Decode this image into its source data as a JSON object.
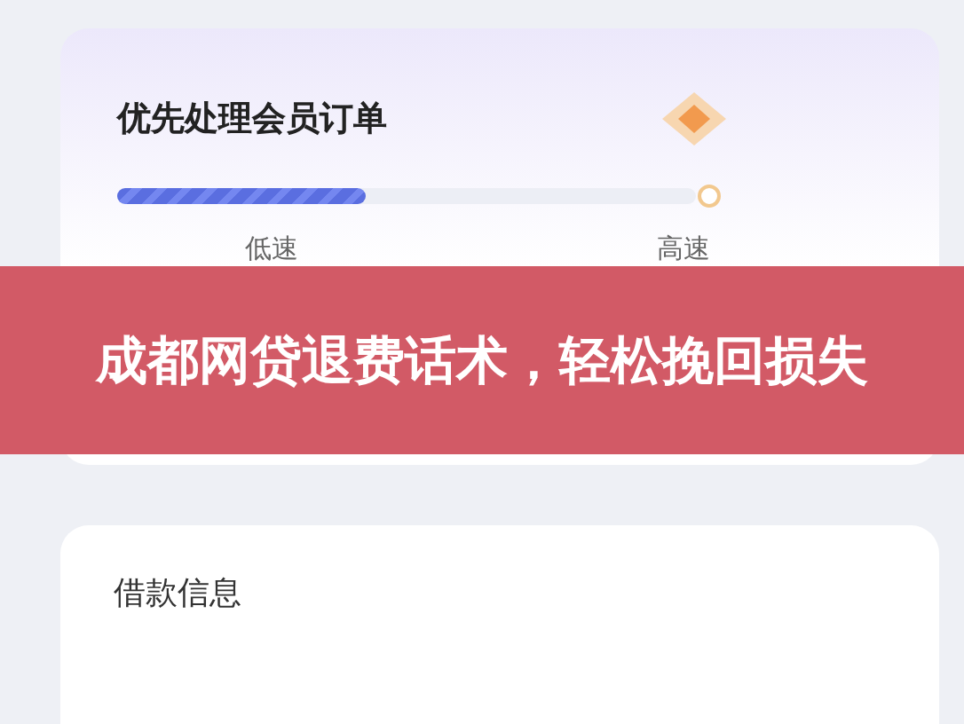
{
  "order_card": {
    "title": "优先处理会员订单",
    "speed": {
      "level": 0.43,
      "labels": [
        "低速",
        "高速"
      ]
    }
  },
  "banner": {
    "text": "成都网贷退费话术，轻松挽回损失"
  },
  "loan_card": {
    "title": "借款信息"
  }
}
